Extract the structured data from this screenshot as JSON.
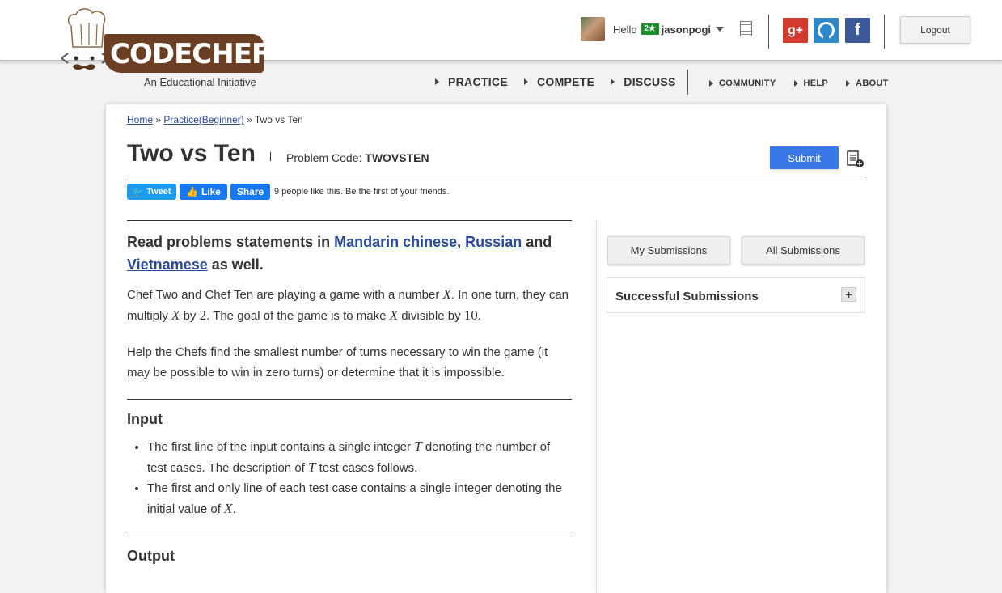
{
  "brand": {
    "logo_text": "CODECHEF",
    "tagline": "An Educational Initiative"
  },
  "user": {
    "greeting": "Hello",
    "stars": "2★",
    "username": "jasonpogi"
  },
  "header": {
    "logout_label": "Logout",
    "social": {
      "gplus": "g+",
      "github": "◯",
      "facebook": "f"
    }
  },
  "nav": {
    "main": [
      "PRACTICE",
      "COMPETE",
      "DISCUSS"
    ],
    "sub": [
      "COMMUNITY",
      "HELP",
      "ABOUT"
    ]
  },
  "breadcrumb": {
    "home": "Home",
    "sep": "»",
    "practice": "Practice(Beginner)",
    "current": "Two vs Ten"
  },
  "problem": {
    "title": "Two vs Ten",
    "code_label": "Problem Code:",
    "code": "TWOVSTEN",
    "submit_label": "Submit"
  },
  "share": {
    "tweet": "Tweet",
    "like": "Like",
    "share": "Share",
    "likes_text": "9 people like this. Be the first of your friends."
  },
  "statement": {
    "lang_prefix": "Read problems statements in",
    "lang1": "Mandarin chinese",
    "comma": ",",
    "lang2": "Russian",
    "and": "and",
    "lang3": "Vietnamese",
    "lang_suffix": "as well.",
    "p1_a": "Chef Two and Chef Ten are playing a game with a number",
    "p1_b": ". In one turn, they can multiply",
    "p1_c": "by",
    "p1_d": ". The goal of the game is to make",
    "p1_e": "divisible by",
    "p1_f": ".",
    "var_x": "X",
    "num_2": "2",
    "num_10": "10",
    "p2": "Help the Chefs find the smallest number of turns necessary to win the game (it may be possible to win in zero turns) or determine that it is impossible.",
    "input_title": "Input",
    "input1_a": "The first line of the input contains a single integer",
    "input1_b": "denoting the number of test cases. The description of",
    "input1_c": "test cases follows.",
    "var_t": "T",
    "input2_a": "The first and only line of each test case contains a single integer denoting the initial value of",
    "input2_b": ".",
    "output_title": "Output"
  },
  "sidebar": {
    "my_submissions": "My Submissions",
    "all_submissions": "All Submissions",
    "successful_submissions": "Successful Submissions",
    "expand": "+"
  }
}
